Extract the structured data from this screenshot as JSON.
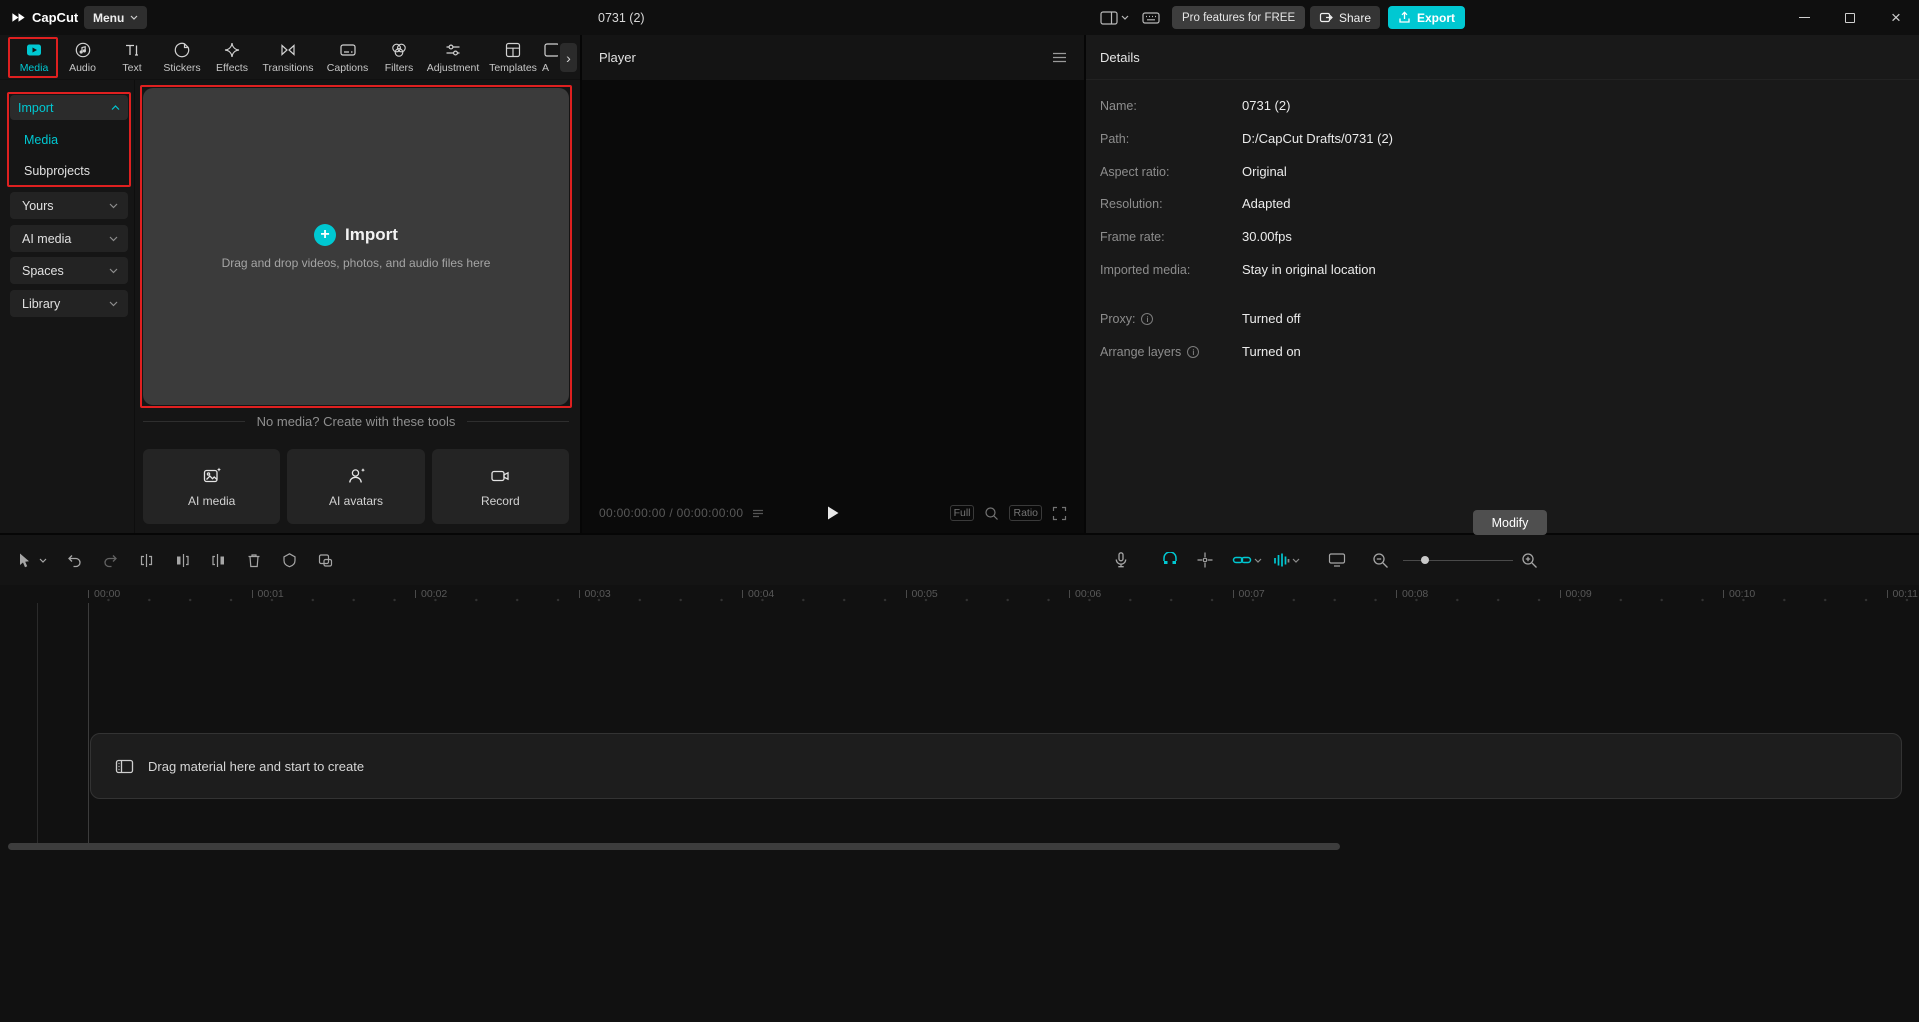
{
  "titlebar": {
    "app_name": "CapCut",
    "menu_label": "Menu",
    "project_title": "0731 (2)",
    "pro_badge": "Pro features for FREE",
    "share_label": "Share",
    "export_label": "Export"
  },
  "media_panel": {
    "tabs": [
      {
        "label": "Media",
        "icon": "media-icon",
        "active": true
      },
      {
        "label": "Audio",
        "icon": "audio-icon",
        "active": false
      },
      {
        "label": "Text",
        "icon": "text-icon",
        "active": false
      },
      {
        "label": "Stickers",
        "icon": "stickers-icon",
        "active": false
      },
      {
        "label": "Effects",
        "icon": "effects-icon",
        "active": false
      },
      {
        "label": "Transitions",
        "icon": "transitions-icon",
        "active": false
      },
      {
        "label": "Captions",
        "icon": "captions-icon",
        "active": false
      },
      {
        "label": "Filters",
        "icon": "filters-icon",
        "active": false
      },
      {
        "label": "Adjustment",
        "icon": "adjustment-icon",
        "active": false
      },
      {
        "label": "Templates",
        "icon": "templates-icon",
        "active": false
      },
      {
        "label": "A",
        "icon": "clipped-tab",
        "active": false
      }
    ],
    "sidebar": {
      "import_group": {
        "label": "Import",
        "expanded": true
      },
      "import_children": [
        {
          "label": "Media",
          "selected": true
        },
        {
          "label": "Subprojects",
          "selected": false
        }
      ],
      "groups": [
        {
          "label": "Yours"
        },
        {
          "label": "AI media"
        },
        {
          "label": "Spaces"
        },
        {
          "label": "Library"
        }
      ]
    },
    "import_area": {
      "title": "Import",
      "subtitle": "Drag and drop videos, photos, and audio files here"
    },
    "create_tools": {
      "heading": "No media? Create with these tools",
      "tools": [
        {
          "label": "AI media",
          "icon": "ai-media-icon"
        },
        {
          "label": "AI avatars",
          "icon": "ai-avatars-icon"
        },
        {
          "label": "Record",
          "icon": "record-icon"
        }
      ]
    }
  },
  "player": {
    "title": "Player",
    "timecode": "00:00:00:00 / 00:00:00:00",
    "full_label": "Full",
    "ratio_label": "Ratio"
  },
  "details": {
    "title": "Details",
    "fields": [
      {
        "label": "Name:",
        "value": "0731 (2)"
      },
      {
        "label": "Path:",
        "value": "D:/CapCut Drafts/0731 (2)"
      },
      {
        "label": "Aspect ratio:",
        "value": "Original"
      },
      {
        "label": "Resolution:",
        "value": "Adapted"
      },
      {
        "label": "Frame rate:",
        "value": "30.00fps"
      },
      {
        "label": "Imported media:",
        "value": "Stay in original location"
      },
      {
        "label": "Proxy:",
        "value": "Turned off",
        "info": true
      },
      {
        "label": "Arrange layers",
        "value": "Turned on",
        "info": true
      }
    ],
    "modify_label": "Modify"
  },
  "timeline": {
    "ruler": [
      "00:00",
      "00:01",
      "00:02",
      "00:03",
      "00:04",
      "00:05",
      "00:06",
      "00:07",
      "00:08",
      "00:09",
      "00:10",
      "00:11"
    ],
    "drop_hint": "Drag material here and start to create",
    "toolbar_left_icons": [
      "select-tool",
      "tool-dropdown",
      "undo",
      "redo",
      "split",
      "delete-left",
      "delete-right",
      "delete",
      "mask",
      "overlay-extract"
    ],
    "toolbar_right_icons": [
      "microphone",
      "main-track-magnet",
      "snapping",
      "auto-linkage",
      "audio-levels",
      "preview-axis",
      "zoom-out",
      "zoom-slider",
      "zoom-in"
    ]
  },
  "colors": {
    "accent": "#00c8d2",
    "annotation_red": "#df2020",
    "export_button": "#00c8d2"
  }
}
